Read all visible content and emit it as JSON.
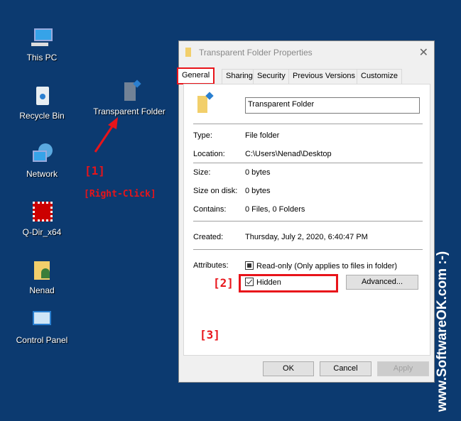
{
  "desktop": {
    "items": [
      {
        "label": "This PC",
        "icon": "computer-icon"
      },
      {
        "label": "Recycle Bin",
        "icon": "recycle-bin-icon"
      },
      {
        "label": "Network",
        "icon": "network-icon"
      },
      {
        "label": "Q-Dir_x64",
        "icon": "qdir-icon"
      },
      {
        "label": "Nenad",
        "icon": "user-folder-icon"
      },
      {
        "label": "Control Panel",
        "icon": "control-panel-icon"
      }
    ],
    "transparent_folder": "Transparent Folder"
  },
  "annotations": {
    "a1": "[1]",
    "right_click": "[Right-Click]",
    "a2": "[2]",
    "a3": "[3]"
  },
  "watermark": "www.SoftwareOK.com :-)",
  "dialog": {
    "title": "Transparent Folder Properties",
    "tabs": [
      "General",
      "Sharing",
      "Security",
      "Previous Versions",
      "Customize"
    ],
    "name_value": "Transparent Folder",
    "fields": [
      {
        "label": "Type:",
        "value": "File folder"
      },
      {
        "label": "Location:",
        "value": "C:\\Users\\Nenad\\Desktop"
      },
      {
        "label": "Size:",
        "value": "0 bytes"
      },
      {
        "label": "Size on disk:",
        "value": "0 bytes"
      },
      {
        "label": "Contains:",
        "value": "0 Files, 0 Folders"
      },
      {
        "label": "Created:",
        "value": "Thursday, July 2, 2020, 6:40:47 PM"
      }
    ],
    "attributes_label": "Attributes:",
    "readonly_label": "Read-only (Only applies to files in folder)",
    "readonly_state": "indeterminate",
    "hidden_label": "Hidden",
    "hidden_checked": true,
    "advanced": "Advanced...",
    "ok": "OK",
    "cancel": "Cancel",
    "apply": "Apply"
  },
  "colors": {
    "desktop": "#0c3a70",
    "annotation": "#e8141a"
  }
}
